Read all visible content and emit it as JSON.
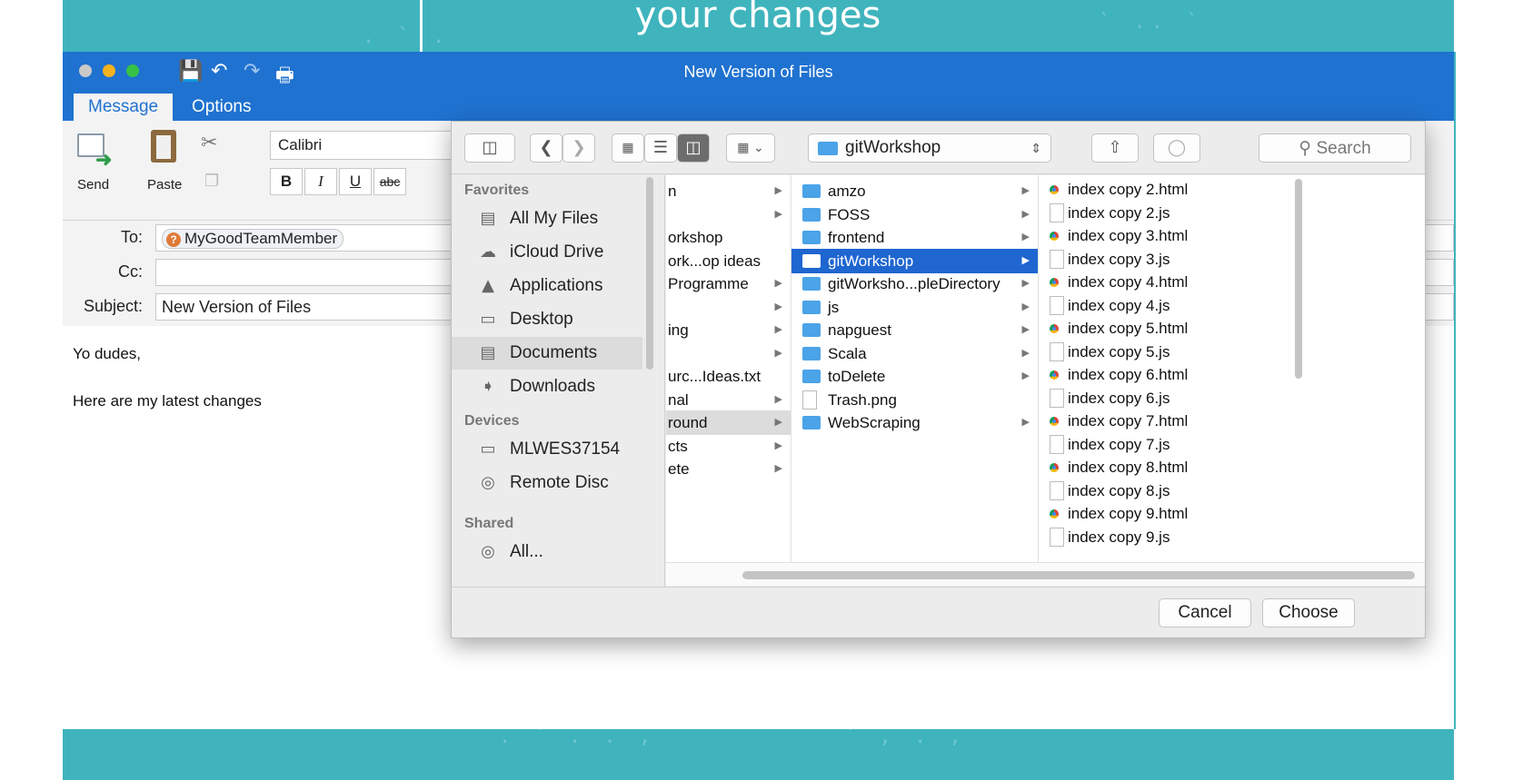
{
  "slide": {
    "caption": "your changes"
  },
  "window": {
    "title": "New Version of Files",
    "tabs": [
      "Message",
      "Options"
    ],
    "toolbar_icons": [
      "save-icon",
      "undo-icon",
      "redo-icon",
      "template-icon"
    ]
  },
  "ribbon": {
    "send_label": "Send",
    "paste_label": "Paste",
    "font_name": "Calibri",
    "format_buttons": [
      "B",
      "I",
      "U",
      "abc"
    ]
  },
  "header": {
    "to_label": "To:",
    "to_recipient": "MyGoodTeamMember",
    "cc_label": "Cc:",
    "cc_value": "",
    "subject_label": "Subject:",
    "subject_value": "New Version of Files"
  },
  "body": {
    "line1": "Yo dudes,",
    "line2": "Here are my latest changes"
  },
  "dialog": {
    "path": "gitWorkshop",
    "search_placeholder": "Search",
    "sidebar": {
      "favorites_heading": "Favorites",
      "favorites": [
        "All My Files",
        "iCloud Drive",
        "Applications",
        "Desktop",
        "Documents",
        "Downloads"
      ],
      "devices_heading": "Devices",
      "devices": [
        "MLWES37154",
        "Remote Disc"
      ],
      "shared_heading": "Shared",
      "shared": [
        "All..."
      ]
    },
    "column1": [
      {
        "name": "n",
        "arrow": true
      },
      {
        "name": "",
        "arrow": true
      },
      {
        "name": "orkshop",
        "arrow": false
      },
      {
        "name": "ork...op ideas",
        "arrow": false
      },
      {
        "name": "Programme",
        "arrow": true
      },
      {
        "name": "",
        "arrow": true
      },
      {
        "name": "ing",
        "arrow": true
      },
      {
        "name": "",
        "arrow": true
      },
      {
        "name": "urc...Ideas.txt",
        "arrow": false
      },
      {
        "name": "nal",
        "arrow": true
      },
      {
        "name": "round",
        "arrow": true
      },
      {
        "name": "cts",
        "arrow": true
      },
      {
        "name": "ete",
        "arrow": true
      }
    ],
    "column2": [
      {
        "name": "amzo",
        "arrow": true
      },
      {
        "name": "FOSS",
        "arrow": true
      },
      {
        "name": "frontend",
        "arrow": true
      },
      {
        "name": "gitWorkshop",
        "arrow": true
      },
      {
        "name": "gitWorksho...pleDirectory",
        "arrow": true
      },
      {
        "name": "js",
        "arrow": true
      },
      {
        "name": "napguest",
        "arrow": true
      },
      {
        "name": "Scala",
        "arrow": true
      },
      {
        "name": "toDelete",
        "arrow": true
      },
      {
        "name": "Trash.png",
        "arrow": false
      },
      {
        "name": "WebScraping",
        "arrow": true
      }
    ],
    "column3": [
      "index copy 2.html",
      "index copy 2.js",
      "index copy 3.html",
      "index copy 3.js",
      "index copy 4.html",
      "index copy 4.js",
      "index copy 5.html",
      "index copy 5.js",
      "index copy 6.html",
      "index copy 6.js",
      "index copy 7.html",
      "index copy 7.js",
      "index copy 8.html",
      "index copy 8.js",
      "index copy 9.html",
      "index copy 9.js"
    ],
    "cancel_label": "Cancel",
    "choose_label": "Choose"
  },
  "colors": {
    "slide_teal": "#3fb4bd",
    "window_blue": "#1f72d0",
    "selection_blue": "#1f66d1",
    "folder_blue": "#4ba3e8"
  }
}
